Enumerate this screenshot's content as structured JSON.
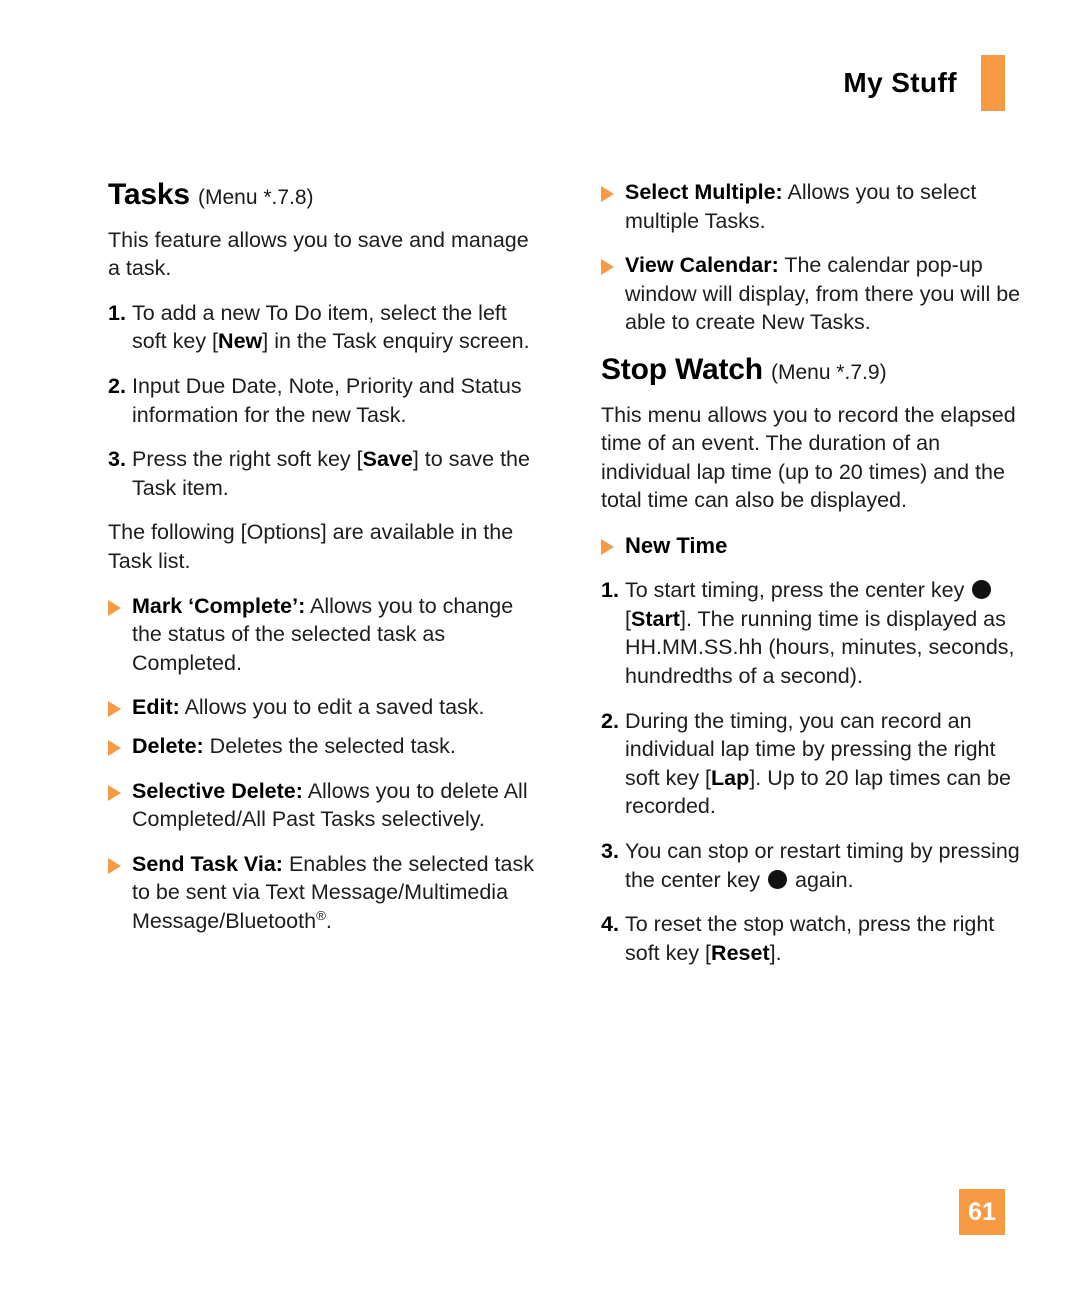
{
  "header": {
    "title": "My Stuff",
    "tab_color": "#f89a43"
  },
  "footer": {
    "page_number": "61",
    "badge_color": "#f89a43"
  },
  "left_column": {
    "heading": {
      "title": "Tasks",
      "menu_ref": "(Menu *.7.8)"
    },
    "intro": "This feature allows you to save and manage a task.",
    "steps": [
      {
        "num": "1.",
        "html": "To add a new To Do item, select the left soft key [<b>New</b>] in the Task enquiry screen."
      },
      {
        "num": "2.",
        "html": "Input Due Date, Note, Priority and Status information for the new Task."
      },
      {
        "num": "3.",
        "html": "Press the right soft key [<b>Save</b>] to save the Task item."
      }
    ],
    "options_intro": "The following [Options] are available in the Task list.",
    "bullets": [
      {
        "html": "<b>Mark ‘Complete’:</b> Allows you to change the status of the selected task as Completed."
      },
      {
        "html": "<b>Edit:</b> Allows you to edit a saved task."
      },
      {
        "html": "<b>Delete:</b> Deletes the selected task."
      },
      {
        "html": "<b>Selective Delete:</b> Allows you to delete All Completed/All Past Tasks selectively."
      },
      {
        "html": "<b>Send Task Via:</b> Enables the selected task to be sent via Text Message/Multimedia Message/Bluetooth<span class=\"sup\">®</span>."
      }
    ]
  },
  "right_column": {
    "bullets_top": [
      {
        "html": "<b>Select Multiple:</b> Allows you to select multiple Tasks."
      },
      {
        "html": "<b>View Calendar:</b> The calendar pop-up window will display, from there you will be able to create New Tasks."
      }
    ],
    "heading": {
      "title": "Stop Watch",
      "menu_ref": "(Menu *.7.9)"
    },
    "intro": "This menu allows you to record the elapsed time of an event. The duration of an individual lap time (up to 20 times) and the total time can also be displayed.",
    "subheading_bullet": "New Time",
    "steps": [
      {
        "num": "1.",
        "html": "To start timing, press the center key <span class=\"key-dot\"></span> [<b>Start</b>]. The running time is displayed as HH.MM.SS.hh (hours, minutes, seconds, hundredths of a second)."
      },
      {
        "num": "2.",
        "html": "During the timing, you can record an individual lap time by pressing the right soft key [<b>Lap</b>]. Up to 20 lap times can be recorded."
      },
      {
        "num": "3.",
        "html": "You can stop or restart timing by pressing the center key <span class=\"key-dot\"></span> again."
      },
      {
        "num": "4.",
        "html": "To reset the stop watch, press the right soft key [<b>Reset</b>]."
      }
    ]
  }
}
